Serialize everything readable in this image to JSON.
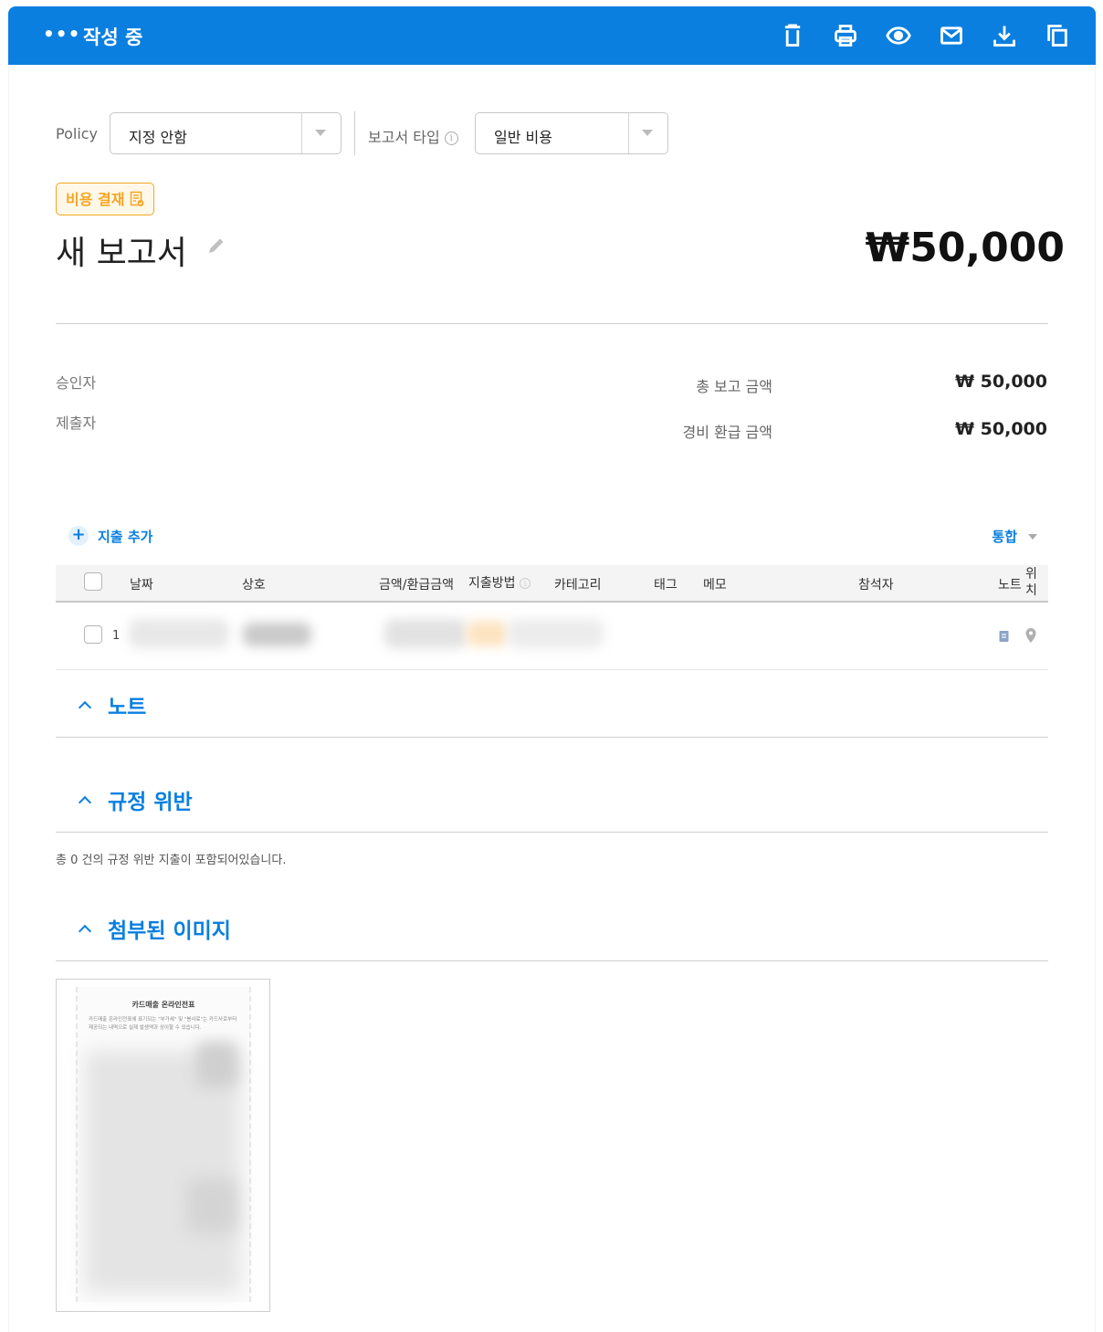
{
  "header": {
    "more_label": "•••",
    "status": "작성 중",
    "actions": [
      "trash-icon",
      "print-icon",
      "eye-icon",
      "mail-icon",
      "download-icon",
      "copy-icon"
    ]
  },
  "policy": {
    "label": "Policy",
    "value": "지정 안함"
  },
  "report_type": {
    "label": "보고서 타입",
    "info": "i",
    "value": "일반 비용"
  },
  "badge": {
    "label": "비용 결재"
  },
  "report": {
    "title": "새 보고서",
    "total": "₩50,000"
  },
  "summary": {
    "approver_label": "승인자",
    "submitter_label": "제출자",
    "total_label": "총 보고 금액",
    "total_value": "₩ 50,000",
    "refund_label": "경비 환급 금액",
    "refund_value": "₩ 50,000"
  },
  "expense_actions": {
    "add_label": "지출 추가",
    "plus": "+",
    "merge_label": "통합"
  },
  "table": {
    "columns": {
      "date": "날짜",
      "merchant": "상호",
      "amount": "금액/환급금액",
      "method": "지출방법",
      "category": "카테고리",
      "tag": "태그",
      "memo": "메모",
      "attendees": "참석자",
      "note": "노트",
      "location_1": "위",
      "location_2": "치"
    },
    "rows": [
      {
        "index": "1"
      }
    ]
  },
  "sections": {
    "notes": "노트",
    "violations": "규정 위반",
    "violations_text": "총 0 건의 규정 위반 지출이 포함되어있습니다.",
    "images": "첨부된 이미지"
  },
  "attachment": {
    "title": "카드매출 온라인전표",
    "desc": "카드매출 온라인전표에 표기되는 \"부가세\" 및 \"봉사료\"는 카드사로부터 제공되는 내역으로 실제 발생액과 상이할 수 있습니다."
  },
  "colors": {
    "primary": "#0a7fe0",
    "badge": "#f5a623"
  }
}
